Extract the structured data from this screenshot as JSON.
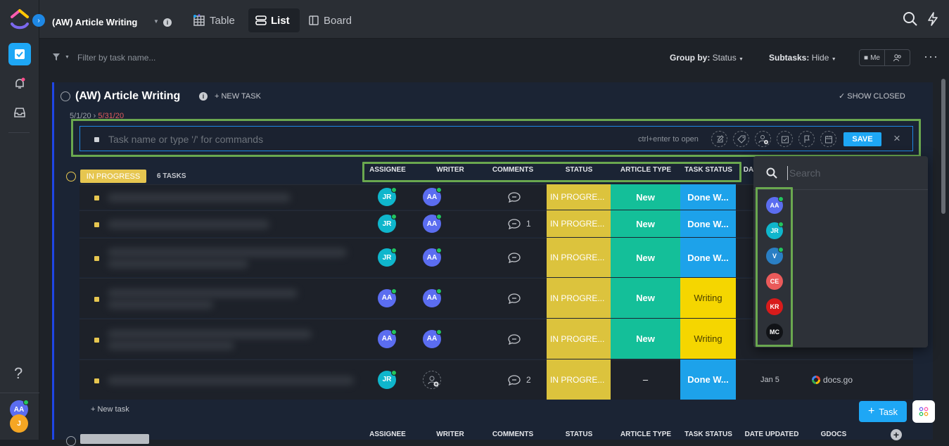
{
  "header": {
    "breadcrumb": "(AW) Article Writing",
    "info": "i",
    "views": [
      "Table",
      "List",
      "Board"
    ]
  },
  "filterbar": {
    "filter_placeholder": "Filter by task name...",
    "group_by_label": "Group by:",
    "group_by_value": "Status",
    "subtasks_label": "Subtasks:",
    "subtasks_value": "Hide",
    "me_label": "Me"
  },
  "list": {
    "title": "(AW) Article Writing",
    "new_task": "+ NEW TASK",
    "show_closed": "SHOW CLOSED",
    "date_start": "5/1/20",
    "date_arrow": "›",
    "date_end": "5/31/20"
  },
  "task_input": {
    "placeholder": "Task name or type '/' for commands",
    "hint": "ctrl+enter to open",
    "save": "SAVE",
    "close": "×"
  },
  "group": {
    "status": "IN PROGRESS",
    "count": "6 TASKS",
    "columns": [
      "ASSIGNEE",
      "WRITER",
      "COMMENTS",
      "STATUS",
      "ARTICLE TYPE",
      "TASK STATUS",
      "DA"
    ],
    "add_task": "+ New task"
  },
  "rows": [
    {
      "assignee": "JR",
      "assignee_color": "#0fb6cc",
      "writer": "AA",
      "comments": "",
      "status": "IN PROGRE...",
      "article_type": "New",
      "task_status": "Done W...",
      "task_status_kind": "done",
      "date": "",
      "gdocs": ""
    },
    {
      "assignee": "JR",
      "assignee_color": "#0fb6cc",
      "writer": "AA",
      "comments": "1",
      "status": "IN PROGRE...",
      "article_type": "New",
      "task_status": "Done W...",
      "task_status_kind": "done",
      "date": "",
      "gdocs": ""
    },
    {
      "assignee": "JR",
      "assignee_color": "#0fb6cc",
      "writer": "AA",
      "comments": "",
      "status": "IN PROGRE...",
      "article_type": "New",
      "task_status": "Done W...",
      "task_status_kind": "done",
      "date": "",
      "gdocs": ""
    },
    {
      "assignee": "AA",
      "assignee_color": "#5b6df0",
      "writer": "AA",
      "comments": "",
      "status": "IN PROGRE...",
      "article_type": "New",
      "task_status": "Writing",
      "task_status_kind": "writing",
      "date": "",
      "gdocs": ""
    },
    {
      "assignee": "AA",
      "assignee_color": "#5b6df0",
      "writer": "AA",
      "comments": "",
      "status": "IN PROGRE...",
      "article_type": "New",
      "task_status": "Writing",
      "task_status_kind": "writing",
      "date": "",
      "gdocs": ""
    },
    {
      "assignee": "JR",
      "assignee_color": "#0fb6cc",
      "writer": "",
      "comments": "2",
      "status": "IN PROGRE...",
      "article_type": "–",
      "task_status": "Done W...",
      "task_status_kind": "done",
      "date": "Jan 5",
      "gdocs": "docs.go"
    }
  ],
  "next_group": {
    "columns": [
      "ASSIGNEE",
      "WRITER",
      "COMMENTS",
      "STATUS",
      "ARTICLE TYPE",
      "TASK STATUS",
      "DATE UPDATED",
      "GDOCS"
    ]
  },
  "dropdown": {
    "search_placeholder": "Search",
    "members": [
      {
        "initials": "AA",
        "color": "#5b6df0",
        "online": true
      },
      {
        "initials": "JR",
        "color": "#0fb6cc",
        "online": true
      },
      {
        "initials": "V",
        "color": "#2a7fc4",
        "online": true
      },
      {
        "initials": "CE",
        "color": "#ea5a5a",
        "online": false
      },
      {
        "initials": "KR",
        "color": "#d81b1b",
        "online": false
      },
      {
        "initials": "MC",
        "color": "#111317",
        "online": false
      }
    ]
  },
  "sidebar": {
    "help": "?",
    "user_initials": "AA",
    "user2_initials": "J"
  },
  "fab": {
    "task": "Task",
    "plus": "+"
  },
  "colors": {
    "accent": "#1ea7f5",
    "in_progress": "#e6c650",
    "article_new": "#14bf99",
    "done": "#1da2ea",
    "writing": "#f5d600",
    "highlight": "#6aa84f"
  }
}
